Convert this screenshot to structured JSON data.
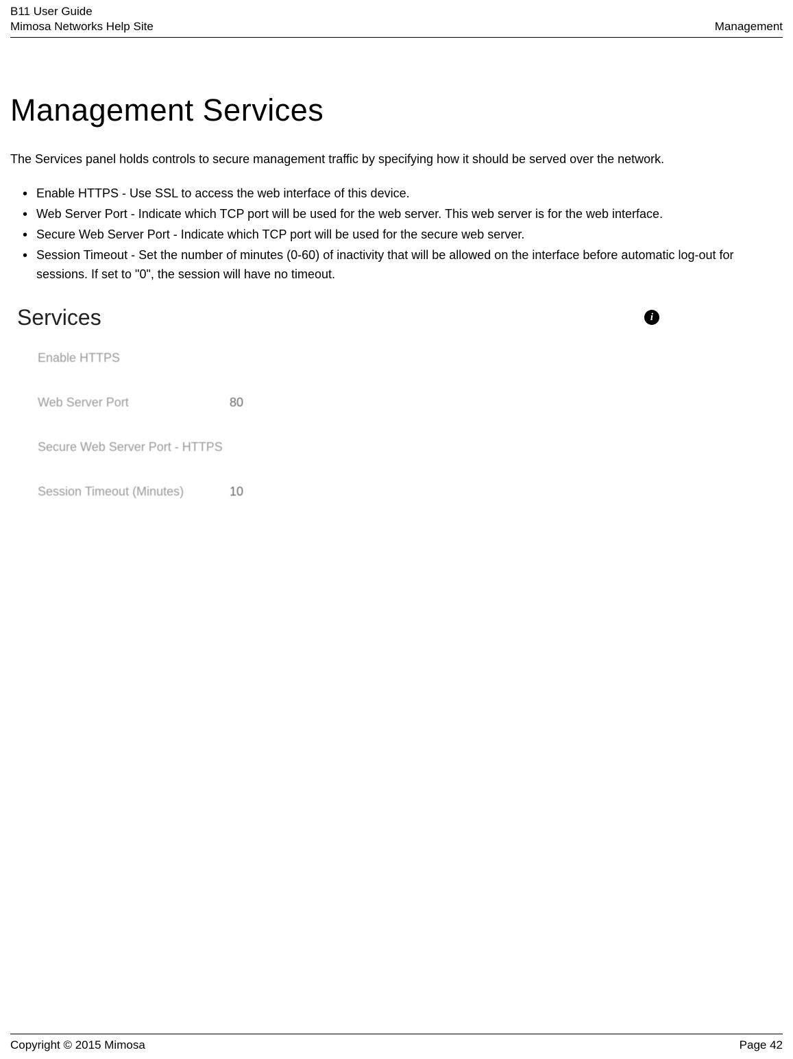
{
  "header": {
    "line1": "B11 User Guide",
    "line2": "Mimosa Networks Help Site",
    "right": "Management"
  },
  "page": {
    "title": "Management Services",
    "intro": "The Services panel holds controls to secure management traffic by specifying how it should be served over the network.",
    "bullets": [
      "Enable HTTPS - Use SSL to access the web interface of this device.",
      "Web Server Port - Indicate which TCP port will be used for the web server. This web server is for the web interface.",
      "Secure Web Server Port - Indicate which TCP port will be used for the secure web server.",
      "Session Timeout - Set the number of minutes (0-60) of inactivity that will be allowed on the interface before automatic log-out for sessions. If set to \"0\", the session will have no timeout."
    ]
  },
  "panel": {
    "title": "Services",
    "rows": [
      {
        "label": "Enable HTTPS",
        "value": ""
      },
      {
        "label": "Web Server Port",
        "value": "80"
      },
      {
        "label": "Secure Web Server Port - HTTPS",
        "value": ""
      },
      {
        "label": "Session Timeout (Minutes)",
        "value": "10"
      }
    ]
  },
  "footer": {
    "copyright": "Copyright © 2015 Mimosa",
    "page": "Page 42"
  }
}
